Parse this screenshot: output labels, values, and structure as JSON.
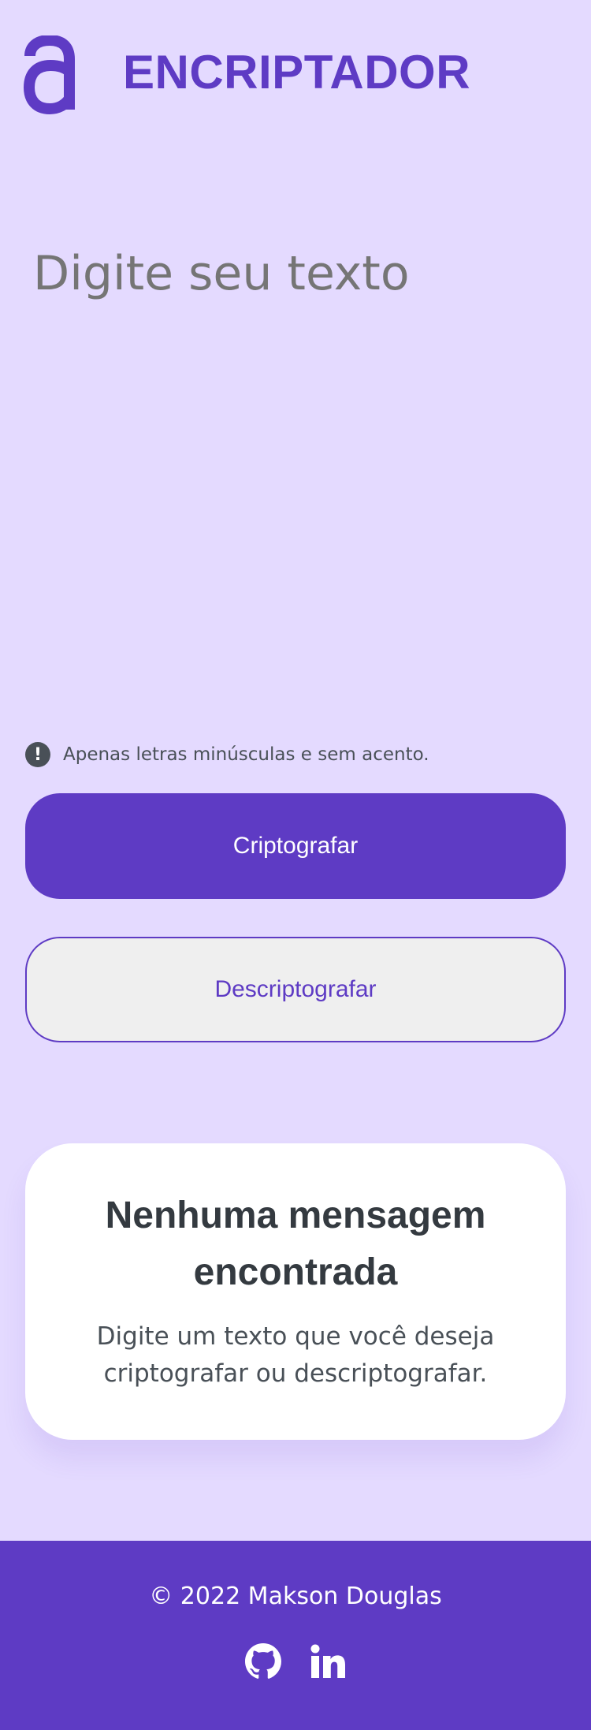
{
  "header": {
    "logo_icon": "alura-a-logo-icon",
    "title": "ENCRIPTADOR"
  },
  "input": {
    "placeholder": "Digite seu texto",
    "value": ""
  },
  "warning": {
    "icon": "exclamation-circle-icon",
    "text": "Apenas letras minúsculas e sem acento."
  },
  "buttons": {
    "encrypt_label": "Criptografar",
    "decrypt_label": "Descriptografar"
  },
  "output": {
    "title": "Nenhuma mensagem encontrada",
    "subtitle": "Digite um texto que você deseja criptografar ou descriptografar."
  },
  "footer": {
    "copyright": "© 2022 Makson Douglas",
    "social": [
      {
        "icon": "github-icon"
      },
      {
        "icon": "linkedin-icon"
      }
    ]
  },
  "colors": {
    "background": "#e4daff",
    "accent": "#5e3bc4",
    "card": "#ffffff",
    "text_dark": "#343a40",
    "text_muted": "#495057",
    "placeholder": "#757575",
    "secondary_button_bg": "#efefef"
  }
}
